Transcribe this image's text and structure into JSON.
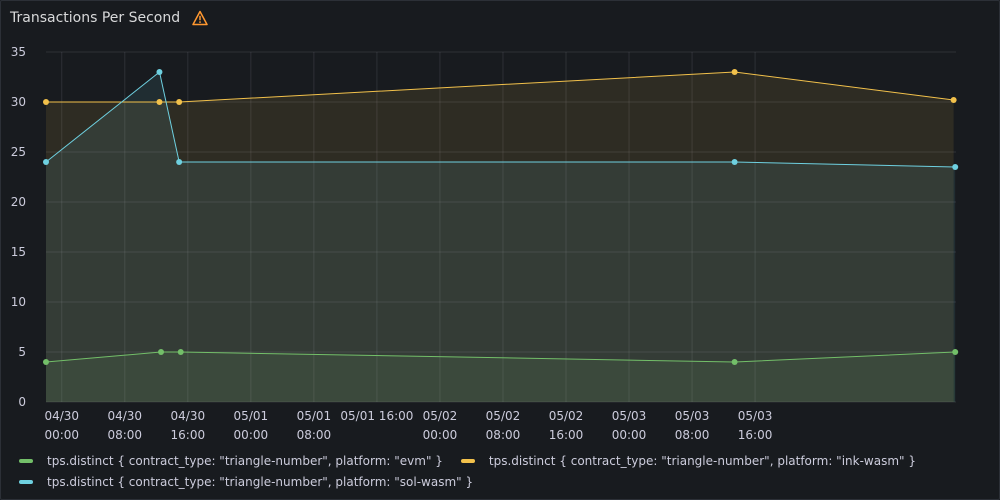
{
  "panel": {
    "title": "Transactions Per Second"
  },
  "colors": {
    "evm": "#73bf69",
    "ink": "#f2c14b",
    "sol": "#6ed0e0"
  },
  "chart_data": {
    "type": "line",
    "title": "Transactions Per Second",
    "ylim": [
      0,
      35
    ],
    "yticks": [
      0,
      5,
      10,
      15,
      20,
      25,
      30,
      35
    ],
    "xlim_hours": [
      -2,
      113.5
    ],
    "xticks": [
      {
        "h": 0,
        "label": [
          "04/30",
          "00:00"
        ]
      },
      {
        "h": 8,
        "label": [
          "04/30",
          "08:00"
        ]
      },
      {
        "h": 16,
        "label": [
          "04/30",
          "16:00"
        ]
      },
      {
        "h": 24,
        "label": [
          "05/01",
          "00:00"
        ]
      },
      {
        "h": 32,
        "label": [
          "05/01",
          "08:00"
        ]
      },
      {
        "h": 40,
        "label": [
          "05/01 16:00",
          ""
        ]
      },
      {
        "h": 48,
        "label": [
          "05/02",
          "00:00"
        ]
      },
      {
        "h": 56,
        "label": [
          "05/02",
          "08:00"
        ]
      },
      {
        "h": 64,
        "label": [
          "05/02",
          "16:00"
        ]
      },
      {
        "h": 72,
        "label": [
          "05/03",
          "00:00"
        ]
      },
      {
        "h": 80,
        "label": [
          "05/03",
          "08:00"
        ]
      },
      {
        "h": 88,
        "label": [
          "05/03",
          "16:00"
        ]
      }
    ],
    "grid": true,
    "legend_position": "bottom",
    "series": [
      {
        "name": "tps.distinct { contract_type: \"triangle-number\", platform: \"evm\" }",
        "color": "#73bf69",
        "points": [
          [
            -2.0,
            4.0
          ],
          [
            12.6,
            5.0
          ],
          [
            15.1,
            5.0
          ],
          [
            85.4,
            4.0
          ],
          [
            113.4,
            5.0
          ]
        ]
      },
      {
        "name": "tps.distinct { contract_type: \"triangle-number\", platform: \"ink-wasm\" }",
        "color": "#f2c14b",
        "points": [
          [
            -2.0,
            30.0
          ],
          [
            12.4,
            30.0
          ],
          [
            14.9,
            30.0
          ],
          [
            85.4,
            33.0
          ],
          [
            113.2,
            30.2
          ]
        ]
      },
      {
        "name": "tps.distinct { contract_type: \"triangle-number\", platform: \"sol-wasm\" }",
        "color": "#6ed0e0",
        "points": [
          [
            -2.0,
            24.0
          ],
          [
            12.4,
            33.0
          ],
          [
            14.9,
            24.0
          ],
          [
            85.4,
            24.0
          ],
          [
            113.4,
            23.5
          ]
        ]
      }
    ]
  }
}
